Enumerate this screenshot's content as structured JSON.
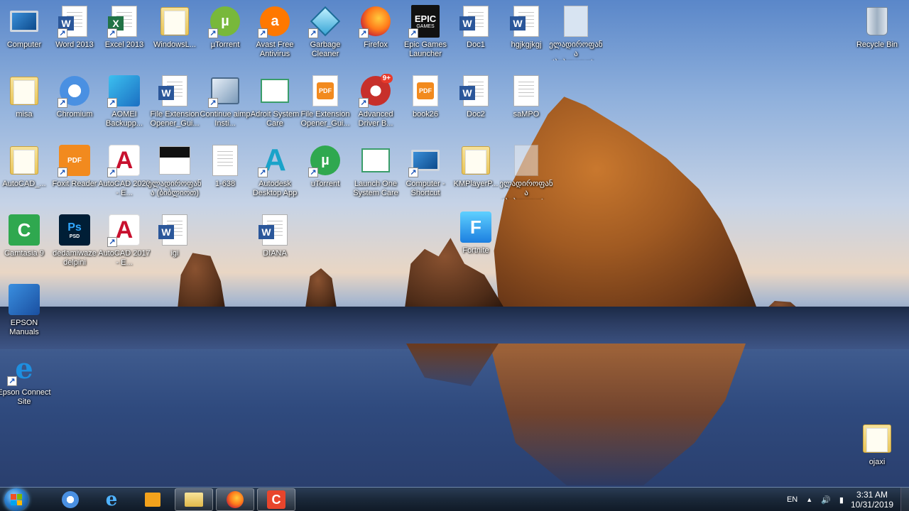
{
  "desktop": {
    "icons": {
      "computer": "Computer",
      "word2013": "Word 2013",
      "excel2013": "Excel 2013",
      "windowsl": "WindowsL...",
      "utorrent1": "µTorrent",
      "avast": "Avast Free Antivirus",
      "garbage": "Garbage Cleaner",
      "firefox": "Firefox",
      "epic": "Epic Games Launcher",
      "doc1": "Doc1",
      "hgjkgjkgj": "hgjkgjkgj",
      "georgian1": "ელადიროფანა (ბიბლიოთ)...",
      "recycle": "Recycle Bin",
      "misa": "misa",
      "chromium": "Chromium",
      "aomei": "AOMEI Backupp...",
      "fileext1": "File Extension Opener_Gui...",
      "continue": "Continue aimp Insti...",
      "adroit": "Adroit System Care",
      "fileext2": "File Extension Opener_Gui...",
      "advanced": "Advanced Driver B...",
      "book26": "book26",
      "doc2": "Doc2",
      "sampo": "saMPO",
      "autocad_folder": "AutoCAD_...",
      "foxit": "Foxit Reader",
      "autocad2020": "AutoCAD 2020 - E...",
      "georgian2": "ელადიროფანა (ბიბლიოთ)",
      "file1638": "1-638",
      "autodesk": "Autodesk Desktop App",
      "utorrent2": "uTorrent",
      "launchone": "Launch One System Care",
      "computer_shortcut": "Computer - Shortcut",
      "kmplayer": "KMPlayerP...",
      "georgian3": "ელადიროფანა (ბიბლიოთ)...",
      "camtasia": "Camtasia 9",
      "dedamiwaze": "dedamiwaze delpini",
      "autocad2017": "AutoCAD 2017 - E...",
      "igi": "igi",
      "diana": "DIANA",
      "fortnite": "Fortnite",
      "epson_manuals": "EPSON Manuals",
      "epson_connect": "Epson Connect Site",
      "ojaxi": "ojaxi"
    },
    "glyphs": {
      "word": "W",
      "excel": "X",
      "epic": "EPIC",
      "epic_sub": "GAMES",
      "pdf": "PDF",
      "ps": "Ps",
      "ps_sub": "PSD",
      "autocad": "A",
      "autodesk": "A",
      "badge_9": "9+",
      "fortnite": "F",
      "utorrent": "µ",
      "avast": "a",
      "shortcut_arrow": "↗"
    }
  },
  "taskbar": {
    "language": "EN",
    "time": "3:31 AM",
    "date": "10/31/2019",
    "tray_chevron": "▲",
    "volume_icon": "🔊",
    "network_icon": "▮"
  },
  "colors": {
    "word": "#2b579a",
    "excel": "#217346",
    "utorrent": "#78b83b",
    "avast": "#ff7800",
    "autocad": "#c8102e",
    "camtasia": "#2fa84f",
    "photoshop": "#001e36"
  }
}
